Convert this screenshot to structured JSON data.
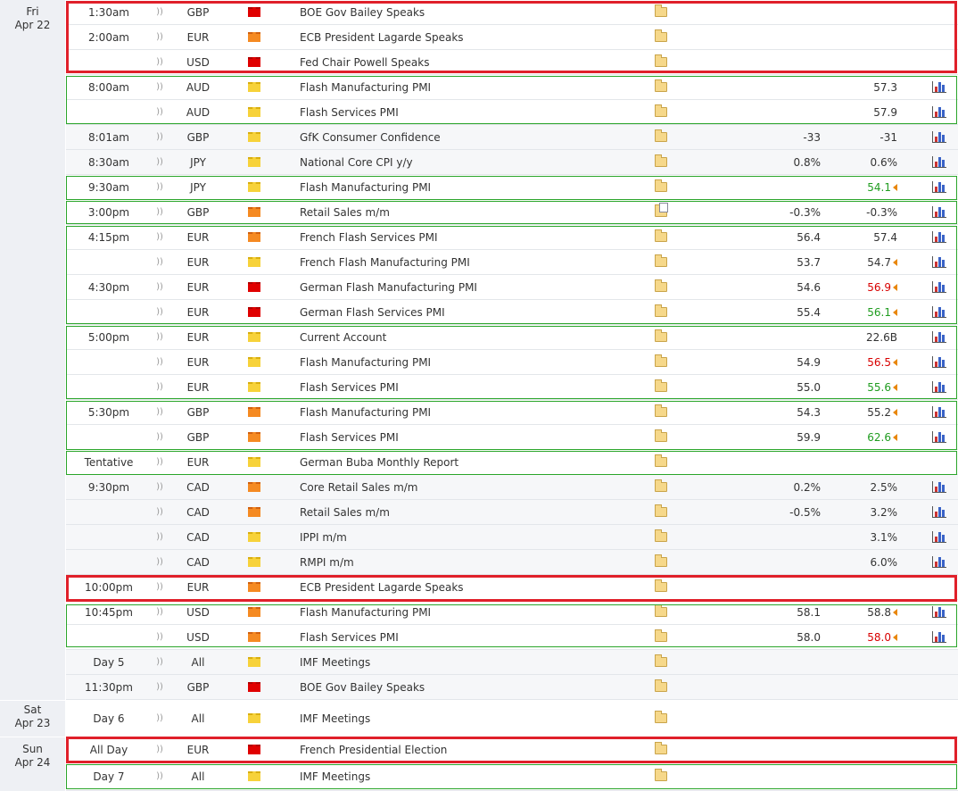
{
  "dates": [
    {
      "day": "Fri",
      "date": "Apr 22"
    },
    {
      "day": "Sat",
      "date": "Apr 23"
    },
    {
      "day": "Sun",
      "date": "Apr 24"
    }
  ],
  "events": [
    {
      "time": "1:30am",
      "currency": "GBP",
      "impact": "high",
      "event": "BOE Gov Bailey Speaks",
      "actual": "",
      "previous": "",
      "graph": false
    },
    {
      "time": "2:00am",
      "currency": "EUR",
      "impact": "medium",
      "event": "ECB President Lagarde Speaks",
      "actual": "",
      "previous": "",
      "graph": false
    },
    {
      "time": "",
      "currency": "USD",
      "impact": "high",
      "event": "Fed Chair Powell Speaks",
      "actual": "",
      "previous": "",
      "graph": false
    },
    {
      "time": "8:00am",
      "currency": "AUD",
      "impact": "low",
      "event": "Flash Manufacturing PMI",
      "actual": "",
      "previous": "57.3",
      "graph": true
    },
    {
      "time": "",
      "currency": "AUD",
      "impact": "low",
      "event": "Flash Services PMI",
      "actual": "",
      "previous": "57.9",
      "graph": true
    },
    {
      "time": "8:01am",
      "currency": "GBP",
      "impact": "low",
      "event": "GfK Consumer Confidence",
      "actual": "-33",
      "previous": "-31",
      "graph": true
    },
    {
      "time": "8:30am",
      "currency": "JPY",
      "impact": "low",
      "event": "National Core CPI y/y",
      "actual": "0.8%",
      "previous": "0.6%",
      "graph": true
    },
    {
      "time": "9:30am",
      "currency": "JPY",
      "impact": "low",
      "event": "Flash Manufacturing PMI",
      "actual": "",
      "previous": "54.1",
      "prev_color": "green",
      "arrow": true,
      "graph": true
    },
    {
      "time": "3:00pm",
      "currency": "GBP",
      "impact": "medium",
      "event": "Retail Sales m/m",
      "actual": "-0.3%",
      "previous": "-0.3%",
      "graph": true,
      "detail": "doc"
    },
    {
      "time": "4:15pm",
      "currency": "EUR",
      "impact": "medium",
      "event": "French Flash Services PMI",
      "actual": "56.4",
      "previous": "57.4",
      "graph": true
    },
    {
      "time": "",
      "currency": "EUR",
      "impact": "low",
      "event": "French Flash Manufacturing PMI",
      "actual": "53.7",
      "previous": "54.7",
      "arrow": true,
      "graph": true
    },
    {
      "time": "4:30pm",
      "currency": "EUR",
      "impact": "high",
      "event": "German Flash Manufacturing PMI",
      "actual": "54.6",
      "previous": "56.9",
      "prev_color": "red",
      "arrow": true,
      "graph": true
    },
    {
      "time": "",
      "currency": "EUR",
      "impact": "high",
      "event": "German Flash Services PMI",
      "actual": "55.4",
      "previous": "56.1",
      "prev_color": "green",
      "arrow": true,
      "graph": true
    },
    {
      "time": "5:00pm",
      "currency": "EUR",
      "impact": "low",
      "event": "Current Account",
      "actual": "",
      "previous": "22.6B",
      "graph": true
    },
    {
      "time": "",
      "currency": "EUR",
      "impact": "low",
      "event": "Flash Manufacturing PMI",
      "actual": "54.9",
      "previous": "56.5",
      "prev_color": "red",
      "arrow": true,
      "graph": true
    },
    {
      "time": "",
      "currency": "EUR",
      "impact": "low",
      "event": "Flash Services PMI",
      "actual": "55.0",
      "previous": "55.6",
      "prev_color": "green",
      "arrow": true,
      "graph": true
    },
    {
      "time": "5:30pm",
      "currency": "GBP",
      "impact": "medium",
      "event": "Flash Manufacturing PMI",
      "actual": "54.3",
      "previous": "55.2",
      "arrow": true,
      "graph": true
    },
    {
      "time": "",
      "currency": "GBP",
      "impact": "medium",
      "event": "Flash Services PMI",
      "actual": "59.9",
      "previous": "62.6",
      "prev_color": "green",
      "arrow": true,
      "graph": true
    },
    {
      "time": "Tentative",
      "currency": "EUR",
      "impact": "low",
      "event": "German Buba Monthly Report",
      "actual": "",
      "previous": "",
      "graph": false
    },
    {
      "time": "9:30pm",
      "currency": "CAD",
      "impact": "medium",
      "event": "Core Retail Sales m/m",
      "actual": "0.2%",
      "previous": "2.5%",
      "graph": true
    },
    {
      "time": "",
      "currency": "CAD",
      "impact": "medium",
      "event": "Retail Sales m/m",
      "actual": "-0.5%",
      "previous": "3.2%",
      "graph": true
    },
    {
      "time": "",
      "currency": "CAD",
      "impact": "low",
      "event": "IPPI m/m",
      "actual": "",
      "previous": "3.1%",
      "graph": true
    },
    {
      "time": "",
      "currency": "CAD",
      "impact": "low",
      "event": "RMPI m/m",
      "actual": "",
      "previous": "6.0%",
      "graph": true
    },
    {
      "time": "10:00pm",
      "currency": "EUR",
      "impact": "medium",
      "event": "ECB President Lagarde Speaks",
      "actual": "",
      "previous": "",
      "graph": false
    },
    {
      "time": "10:45pm",
      "currency": "USD",
      "impact": "medium",
      "event": "Flash Manufacturing PMI",
      "actual": "58.1",
      "previous": "58.8",
      "arrow": true,
      "graph": true
    },
    {
      "time": "",
      "currency": "USD",
      "impact": "medium",
      "event": "Flash Services PMI",
      "actual": "58.0",
      "previous": "58.0",
      "prev_color": "red",
      "arrow": true,
      "graph": true
    },
    {
      "time": "Day 5",
      "currency": "All",
      "impact": "low",
      "event": "IMF Meetings",
      "actual": "",
      "previous": "",
      "graph": false
    },
    {
      "time": "11:30pm",
      "currency": "GBP",
      "impact": "high",
      "event": "BOE Gov Bailey Speaks",
      "actual": "",
      "previous": "",
      "graph": false
    },
    {
      "time": "Day 6",
      "currency": "All",
      "impact": "low",
      "event": "IMF Meetings",
      "actual": "",
      "previous": "",
      "graph": false
    },
    {
      "time": "All Day",
      "currency": "EUR",
      "impact": "high",
      "event": "French Presidential Election",
      "actual": "",
      "previous": "",
      "graph": false
    },
    {
      "time": "Day 7",
      "currency": "All",
      "impact": "low",
      "event": "IMF Meetings",
      "actual": "",
      "previous": "",
      "graph": false
    }
  ],
  "colors": {
    "highlight_red": "#e0202a",
    "highlight_green": "#2aa52a",
    "date_bg": "#eef0f4"
  }
}
